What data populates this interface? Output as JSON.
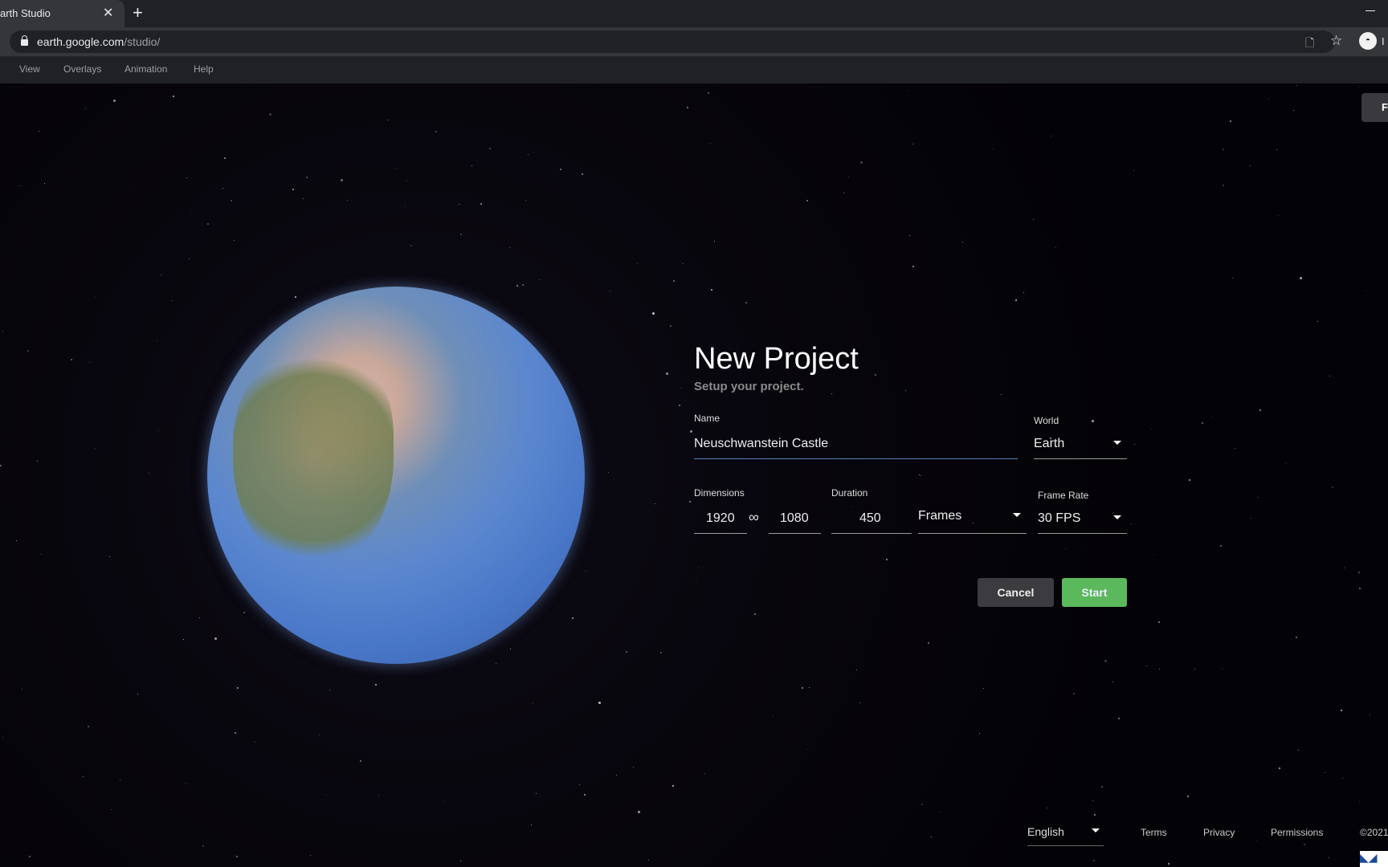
{
  "browser": {
    "tab_title": "arth Studio",
    "url_host": "earth.google.com",
    "url_path": "/studio/",
    "profile_label": "I"
  },
  "menu": [
    "View",
    "Overlays",
    "Animation",
    "Help"
  ],
  "top_right_button": "F",
  "form": {
    "title": "New Project",
    "subtitle": "Setup your project.",
    "name_label": "Name",
    "name_value": "Neuschwanstein Castle",
    "world_label": "World",
    "world_value": "Earth",
    "dimensions_label": "Dimensions",
    "width": "1920",
    "height": "1080",
    "duration_label": "Duration",
    "duration_value": "450",
    "duration_unit": "Frames",
    "frame_rate_label": "Frame Rate",
    "frame_rate_value": "30 FPS",
    "cancel": "Cancel",
    "start": "Start"
  },
  "footer": {
    "language": "English",
    "terms": "Terms",
    "privacy": "Privacy",
    "permissions": "Permissions",
    "copyright": "©2021"
  },
  "colors": {
    "start_button": "#5cb85c",
    "cancel_button": "#3c3c40",
    "background": "#05030a"
  }
}
